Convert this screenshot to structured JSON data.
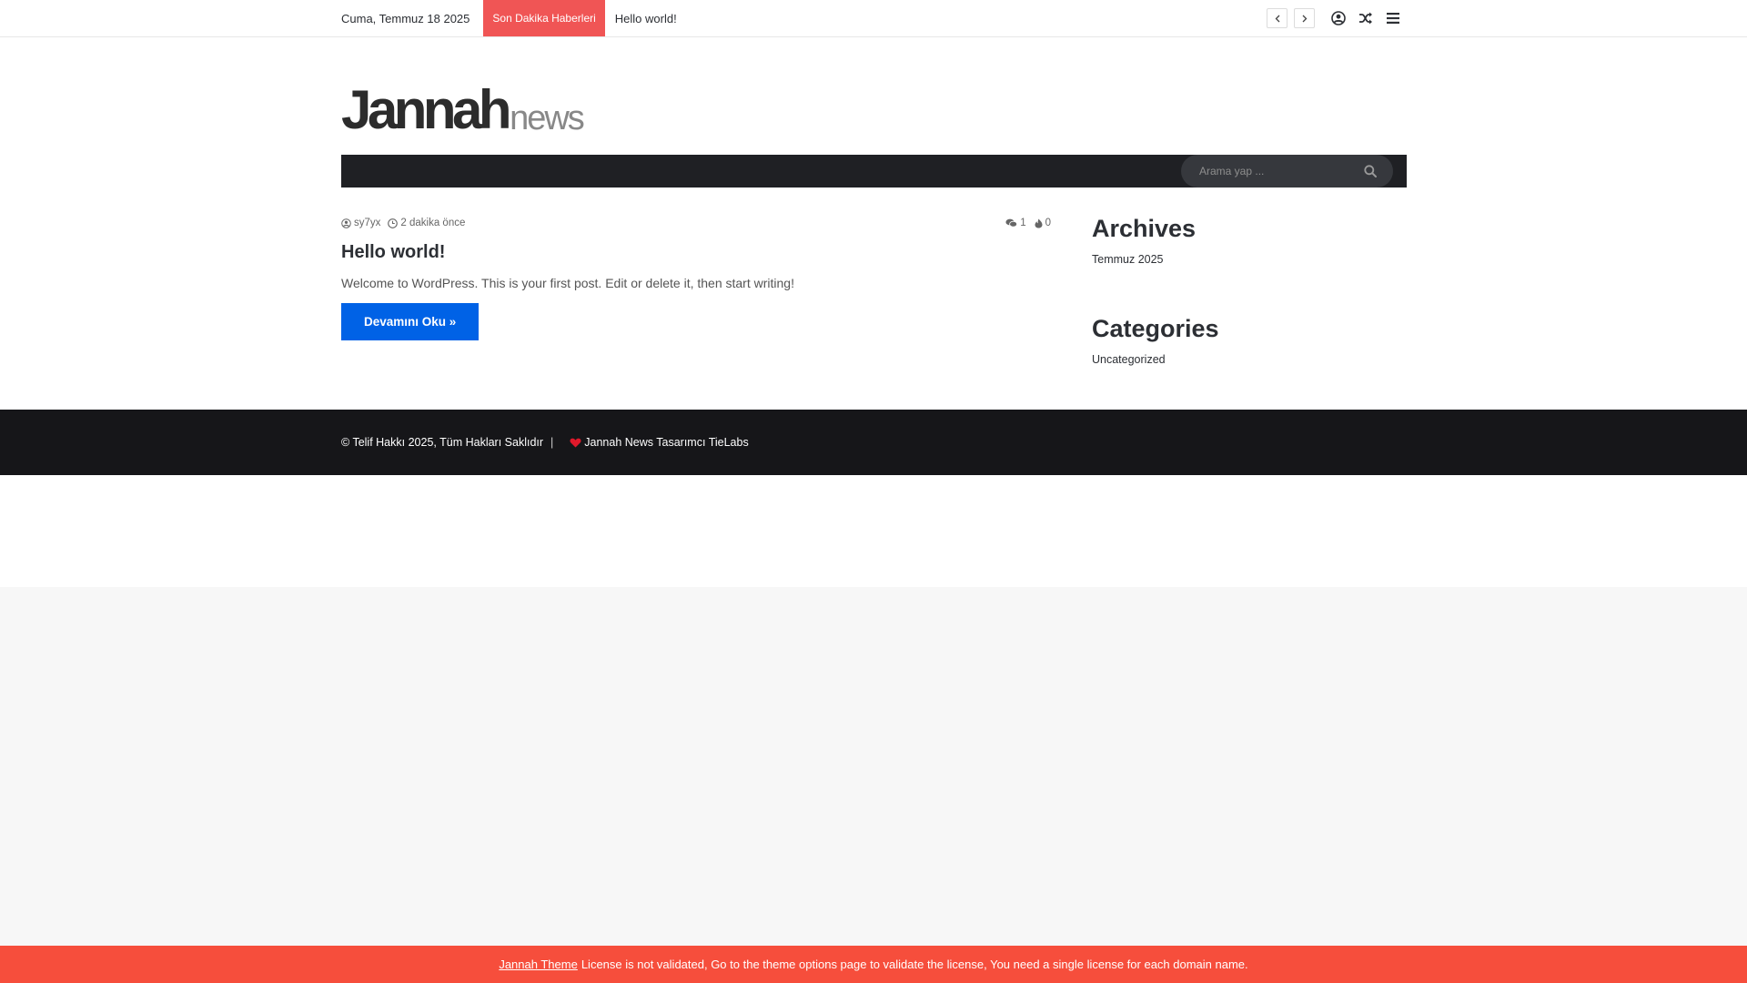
{
  "topbar": {
    "date": "Cuma, Temmuz 18 2025",
    "breaking_label": "Son Dakika Haberleri",
    "breaking_item": "Hello world!",
    "prev_icon": "chevron-left-icon",
    "next_icon": "chevron-right-icon",
    "icons": [
      "user-circle-icon",
      "shuffle-icon",
      "hamburger-menu-icon"
    ]
  },
  "header": {
    "logo_main": "Jannah",
    "logo_sub": "news"
  },
  "search": {
    "placeholder": "Arama yap ...",
    "icon": "search-icon"
  },
  "post": {
    "author": "sy7yx",
    "time": "2 dakika önce",
    "comments": "1",
    "views": "0",
    "title": "Hello world!",
    "excerpt": "Welcome to WordPress. This is your first post. Edit or delete it, then start writing!",
    "read_more": "Devamını Oku »"
  },
  "sidebar": {
    "archives_title": "Archives",
    "archives_item": "Temmuz 2025",
    "categories_title": "Categories",
    "categories_item": "Uncategorized"
  },
  "footer": {
    "copyright": "© Telif Hakkı 2025, Tüm Hakları Saklıdır",
    "separator": "|",
    "credit": "Jannah News Tasarımcı TieLabs"
  },
  "license": {
    "link": "Jannah Theme",
    "message": "License is not validated, Go to the theme options page to validate the license, You need a single license for each domain name."
  },
  "colors": {
    "breaking_bg": "#f05555",
    "nav_bg": "#1f2024",
    "button_bg": "#0062e6",
    "footer_bg": "#161619",
    "license_bg": "#f64e3c",
    "heart": "#e0192b"
  }
}
